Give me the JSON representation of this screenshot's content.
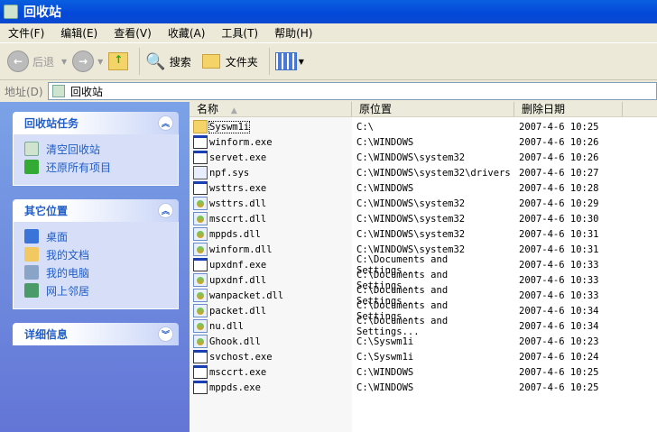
{
  "window": {
    "title": "回收站"
  },
  "menu": [
    "文件(F)",
    "编辑(E)",
    "查看(V)",
    "收藏(A)",
    "工具(T)",
    "帮助(H)"
  ],
  "toolbar": {
    "back": "后退",
    "search": "搜索",
    "folders": "文件夹"
  },
  "address": {
    "label": "地址(D)",
    "value": "回收站"
  },
  "tasks": {
    "title": "回收站任务",
    "items": [
      "清空回收站",
      "还原所有项目"
    ]
  },
  "places": {
    "title": "其它位置",
    "items": [
      "桌面",
      "我的文档",
      "我的电脑",
      "网上邻居"
    ]
  },
  "details": {
    "title": "详细信息"
  },
  "columns": [
    "名称",
    "原位置",
    "删除日期"
  ],
  "files": [
    {
      "name": "Syswm1i",
      "type": "folder",
      "location": "C:\\",
      "date": "2007-4-6 10:25"
    },
    {
      "name": "winform.exe",
      "type": "exe",
      "location": "C:\\WINDOWS",
      "date": "2007-4-6 10:26"
    },
    {
      "name": "servet.exe",
      "type": "exe",
      "location": "C:\\WINDOWS\\system32",
      "date": "2007-4-6 10:26"
    },
    {
      "name": "npf.sys",
      "type": "sys",
      "location": "C:\\WINDOWS\\system32\\drivers",
      "date": "2007-4-6 10:27"
    },
    {
      "name": "wsttrs.exe",
      "type": "exe",
      "location": "C:\\WINDOWS",
      "date": "2007-4-6 10:28"
    },
    {
      "name": "wsttrs.dll",
      "type": "dll",
      "location": "C:\\WINDOWS\\system32",
      "date": "2007-4-6 10:29"
    },
    {
      "name": "msccrt.dll",
      "type": "dll",
      "location": "C:\\WINDOWS\\system32",
      "date": "2007-4-6 10:30"
    },
    {
      "name": "mppds.dll",
      "type": "dll",
      "location": "C:\\WINDOWS\\system32",
      "date": "2007-4-6 10:31"
    },
    {
      "name": "winform.dll",
      "type": "dll",
      "location": "C:\\WINDOWS\\system32",
      "date": "2007-4-6 10:31"
    },
    {
      "name": "upxdnf.exe",
      "type": "exe",
      "location": "C:\\Documents and Settings...",
      "date": "2007-4-6 10:33"
    },
    {
      "name": "upxdnf.dll",
      "type": "dll",
      "location": "C:\\Documents and Settings...",
      "date": "2007-4-6 10:33"
    },
    {
      "name": "wanpacket.dll",
      "type": "dll",
      "location": "C:\\Documents and Settings...",
      "date": "2007-4-6 10:33"
    },
    {
      "name": "packet.dll",
      "type": "dll",
      "location": "C:\\Documents and Settings...",
      "date": "2007-4-6 10:34"
    },
    {
      "name": "nu.dll",
      "type": "dll",
      "location": "C:\\Documents and Settings...",
      "date": "2007-4-6 10:34"
    },
    {
      "name": "Ghook.dll",
      "type": "dll",
      "location": "C:\\Syswm1i",
      "date": "2007-4-6 10:23"
    },
    {
      "name": "svchost.exe",
      "type": "exe",
      "location": "C:\\Syswm1i",
      "date": "2007-4-6 10:24"
    },
    {
      "name": "msccrt.exe",
      "type": "exe",
      "location": "C:\\WINDOWS",
      "date": "2007-4-6 10:25"
    },
    {
      "name": "mppds.exe",
      "type": "exe",
      "location": "C:\\WINDOWS",
      "date": "2007-4-6 10:25"
    }
  ]
}
